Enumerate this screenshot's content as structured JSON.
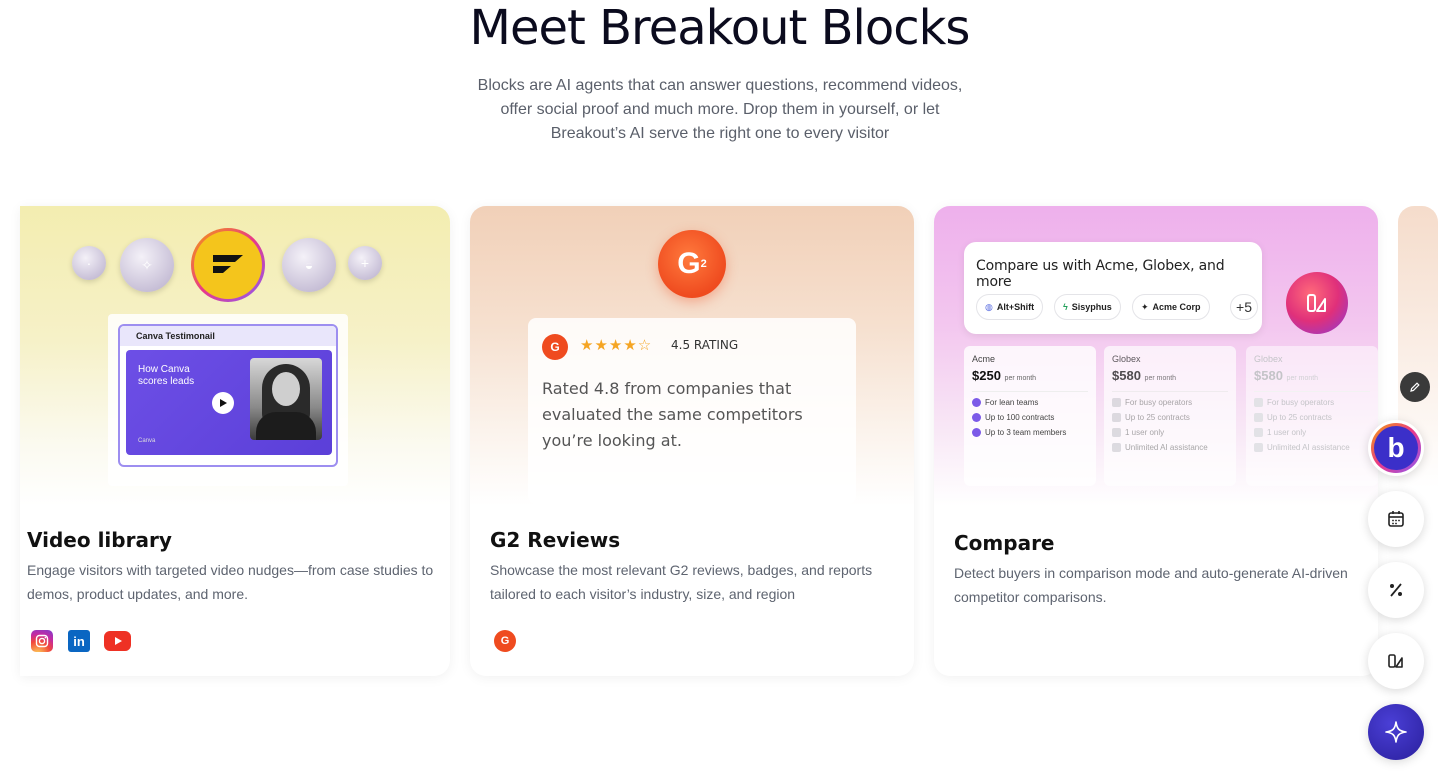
{
  "hero": {
    "title": "Meet Breakout Blocks",
    "subtitle": "Blocks are AI agents that can answer questions, recommend videos, offer social proof and much more. Drop them in yourself, or let Breakout’s AI serve the right one to every visitor"
  },
  "cards": [
    {
      "title": "Video library",
      "description": "Engage visitors with targeted video nudges—from case studies to demos, product updates, and more.",
      "preview": {
        "video_header": "Canva Testimonail",
        "video_caption": "How Canva scores leads",
        "video_brand": "Canva"
      },
      "icons": [
        "instagram-icon",
        "linkedin-icon",
        "youtube-icon"
      ]
    },
    {
      "title": "G2 Reviews",
      "description": "Showcase the most relevant G2 reviews, badges, and reports tailored to each visitor’s industry, size, and region",
      "preview": {
        "stars": "★★★★☆",
        "rating_label": "4.5 RATING",
        "quote": "Rated 4.8 from companies that evaluated the same competitors you’re looking at."
      },
      "icons": [
        "g2-icon"
      ]
    },
    {
      "title": "Compare",
      "description": "Detect buyers in comparison mode and auto-generate AI-driven competitor comparisons.",
      "preview": {
        "prompt": "Compare us with Acme, Globex, and more",
        "chips": [
          "Alt+Shift",
          "Sisyphus",
          "Acme Corp"
        ],
        "more": "+5",
        "per_month": "per month",
        "plans": [
          {
            "name": "Acme",
            "price": "$250",
            "features": [
              "For lean teams",
              "Up to 100 contracts",
              "Up to 3 team members"
            ]
          },
          {
            "name": "Globex",
            "price": "$580",
            "features": [
              "For busy operators",
              "Up to 25 contracts",
              "1 user only",
              "Unlimited AI assistance"
            ]
          },
          {
            "name": "Globex",
            "price": "$580",
            "features": [
              "For busy operators",
              "Up to 25 contracts",
              "1 user only",
              "Unlimited AI assistance"
            ]
          }
        ]
      }
    }
  ],
  "widget": {
    "buttons": [
      "pencil-icon",
      "breakout-logo-icon",
      "calendar-icon",
      "percent-icon",
      "compare-icon",
      "sparkle-icon"
    ],
    "accent": "#3b2fc9"
  }
}
